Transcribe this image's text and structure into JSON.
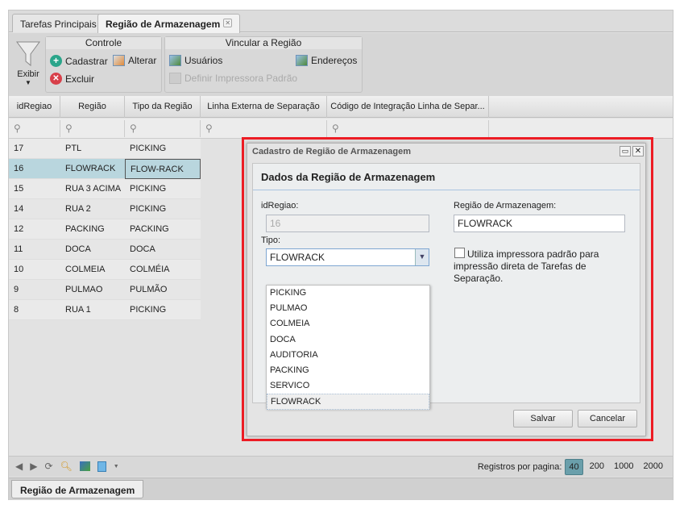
{
  "tabs": [
    {
      "label": "Tarefas Principais"
    },
    {
      "label": "Região de Armazenagem"
    }
  ],
  "toolbar": {
    "exibir": "Exibir",
    "controle": {
      "title": "Controle",
      "cadastrar": "Cadastrar",
      "alterar": "Alterar",
      "excluir": "Excluir"
    },
    "vincular": {
      "title": "Vincular a Região",
      "usuarios": "Usuários",
      "enderecos": "Endereços",
      "definir": "Definir Impressora Padrão"
    }
  },
  "grid": {
    "columns": [
      "idRegiao",
      "Região",
      "Tipo da Região",
      "Linha Externa de Separação",
      "Código de Integração Linha de Separ..."
    ],
    "rows": [
      [
        "17",
        "PTL",
        "PICKING"
      ],
      [
        "16",
        "FLOWRACK",
        "FLOW-RACK"
      ],
      [
        "15",
        "RUA 3 ACIMA",
        "PICKING"
      ],
      [
        "14",
        "RUA 2",
        "PICKING"
      ],
      [
        "12",
        "PACKING",
        "PACKING"
      ],
      [
        "11",
        "DOCA",
        "DOCA"
      ],
      [
        "10",
        "COLMEIA",
        "COLMÉIA"
      ],
      [
        "9",
        "PULMAO",
        "PULMÃO"
      ],
      [
        "8",
        "RUA 1",
        "PICKING"
      ]
    ]
  },
  "pager": {
    "label": "Registros por pagina:",
    "sizes": [
      "40",
      "200",
      "1000",
      "2000"
    ],
    "selected": "40"
  },
  "bottom_tab": "Região de Armazenagem",
  "dialog": {
    "title": "Cadastro de Região de Armazenagem",
    "section": "Dados da Região de Armazenagem",
    "id_label": "idRegiao:",
    "id_value": "16",
    "tipo_label": "Tipo:",
    "tipo_value": "FLOWRACK",
    "regiao_label": "Região de Armazenagem:",
    "regiao_value": "FLOWRACK",
    "checkbox_label": "Utiliza impressora padrão para impressão direta de Tarefas de Separação.",
    "checkbox_checked": false,
    "options": [
      "PICKING",
      "PULMAO",
      "COLMEIA",
      "DOCA",
      "AUDITORIA",
      "PACKING",
      "SERVICO",
      "FLOWRACK"
    ],
    "save": "Salvar",
    "cancel": "Cancelar"
  },
  "colors": {
    "highlight": "#ed1c24",
    "selected_row": "#b9d6de",
    "page_selected": "#6a9fab"
  }
}
